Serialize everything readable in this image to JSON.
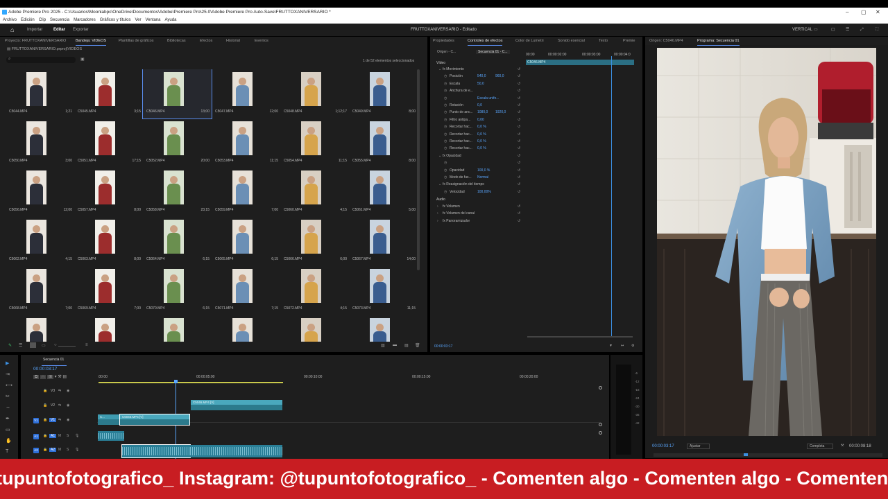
{
  "window": {
    "title": "Adobe Premiere Pro 2025 - C:\\Usuarios\\Moonlabpc\\OneDrive\\Documentos\\Adobe\\Premiere Pro\\25.0\\Adobe Premiere Pro Auto-Save\\FRUTTOXANIVERSARIO *",
    "min": "–",
    "max": "▢",
    "close": "✕"
  },
  "menu": [
    "Archivo",
    "Edición",
    "Clip",
    "Secuencia",
    "Marcadores",
    "Gráficos y títulos",
    "Ver",
    "Ventana",
    "Ayuda"
  ],
  "topbar": {
    "tabs": [
      "Importar",
      "Editar",
      "Exportar"
    ],
    "project_title": "FRUTTOXANIVERSARIO - Editado",
    "layout": "VERTICAL"
  },
  "project": {
    "tabs": [
      "Proyecto: FRUTTOXANIVERSARIO",
      "Bandeja: VIDEOS",
      "Plantillas de gráficos",
      "Bibliotecas",
      "Efectos",
      "Historial",
      "Eventos"
    ],
    "path": "FRUTTOXANIVERSARIO.prproj\\VIDEOS",
    "count": "1 de 52 elementos seleccionados",
    "clips": [
      {
        "name": "C5044.MP4",
        "dur": "1;21"
      },
      {
        "name": "C5045.MP4",
        "dur": "3;15"
      },
      {
        "name": "C5046.MP4",
        "dur": "13;00"
      },
      {
        "name": "C5047.MP4",
        "dur": "12;00"
      },
      {
        "name": "C5048.MP4",
        "dur": "1;12;17"
      },
      {
        "name": "C5049.MP4",
        "dur": "8;00"
      },
      {
        "name": "C5050.MP4",
        "dur": "3;00"
      },
      {
        "name": "C5051.MP4",
        "dur": "17;15"
      },
      {
        "name": "C5052.MP4",
        "dur": "20;00"
      },
      {
        "name": "C5053.MP4",
        "dur": "11;15"
      },
      {
        "name": "C5054.MP4",
        "dur": "11;15"
      },
      {
        "name": "C5055.MP4",
        "dur": "8;00"
      },
      {
        "name": "C5056.MP4",
        "dur": "12;00"
      },
      {
        "name": "C5057.MP4",
        "dur": "8;00"
      },
      {
        "name": "C5058.MP4",
        "dur": "23;15"
      },
      {
        "name": "C5059.MP4",
        "dur": "7;00"
      },
      {
        "name": "C5060.MP4",
        "dur": "4;15"
      },
      {
        "name": "C5061.MP4",
        "dur": "5;00"
      },
      {
        "name": "C5062.MP4",
        "dur": "4;15"
      },
      {
        "name": "C5063.MP4",
        "dur": "8;00"
      },
      {
        "name": "C5064.MP4",
        "dur": "6;15"
      },
      {
        "name": "C5065.MP4",
        "dur": "6;15"
      },
      {
        "name": "C5066.MP4",
        "dur": "6;00"
      },
      {
        "name": "C5067.MP4",
        "dur": "14;00"
      },
      {
        "name": "C5068.MP4",
        "dur": "7;00"
      },
      {
        "name": "C5069.MP4",
        "dur": "7;00"
      },
      {
        "name": "C5070.MP4",
        "dur": "6;15"
      },
      {
        "name": "C5071.MP4",
        "dur": "7;15"
      },
      {
        "name": "C5072.MP4",
        "dur": "4;15"
      },
      {
        "name": "C5073.MP4",
        "dur": "11;15"
      },
      {
        "name": "",
        "dur": ""
      },
      {
        "name": "",
        "dur": ""
      },
      {
        "name": "",
        "dur": ""
      },
      {
        "name": "",
        "dur": ""
      },
      {
        "name": "",
        "dur": ""
      },
      {
        "name": "",
        "dur": ""
      }
    ]
  },
  "effects": {
    "tabs": [
      "Propiedades",
      "Controles de efectos",
      "Color de Lumetri",
      "Sonido esencial",
      "Texto",
      "Premie"
    ],
    "source": "Origen - C...",
    "seq": "Secuencia 01 - C...",
    "ruler": [
      "00:00",
      "00:00:02:00",
      "00:00:03:00",
      "00:00:04:0"
    ],
    "clip_label": "C5046.MP4",
    "section_video": "Vídeo",
    "section_audio": "Audio",
    "rows": [
      {
        "label": "fx Movimiento",
        "v1": "",
        "v2": ""
      },
      {
        "label": "Posición",
        "v1": "540,0",
        "v2": "960,0"
      },
      {
        "label": "Escala",
        "v1": "50,0",
        "v2": ""
      },
      {
        "label": "Anchura de e...",
        "v1": "",
        "v2": ""
      },
      {
        "label": "",
        "v1": "Escala unifo...",
        "v2": ""
      },
      {
        "label": "Rotación",
        "v1": "0,0",
        "v2": ""
      },
      {
        "label": "Punto de anc...",
        "v1": "1080,0",
        "v2": "1920,0"
      },
      {
        "label": "Filtro antipa...",
        "v1": "0,00",
        "v2": ""
      },
      {
        "label": "Recortar hac...",
        "v1": "0,0 %",
        "v2": ""
      },
      {
        "label": "Recortar hac...",
        "v1": "0,0 %",
        "v2": ""
      },
      {
        "label": "Recortar hac...",
        "v1": "0,0 %",
        "v2": ""
      },
      {
        "label": "Recortar hac...",
        "v1": "0,0 %",
        "v2": ""
      },
      {
        "label": "fx Opacidad",
        "v1": "",
        "v2": ""
      },
      {
        "label": "",
        "v1": "",
        "v2": ""
      },
      {
        "label": "Opacidad",
        "v1": "100,0 %",
        "v2": ""
      },
      {
        "label": "Modo de fus...",
        "v1": "Normal",
        "v2": ""
      },
      {
        "label": "fx Reasignación del tiempo",
        "v1": "",
        "v2": ""
      },
      {
        "label": "Velocidad",
        "v1": "100,00%",
        "v2": ""
      }
    ],
    "audio_rows": [
      "fx Volumen",
      "fx Volumen del canal",
      "fx Panoramizador"
    ],
    "timecode": "00:00:03:17"
  },
  "program": {
    "tabs": [
      "Origen: C5046.MP4",
      "Programa: Secuencia 01"
    ],
    "timecode": "00:00:03:17",
    "fit": "Ajustar",
    "quality": "Completa",
    "duration": "00:00:08:18"
  },
  "timeline": {
    "tab": "Secuencia 01",
    "timecode": "00:00:03:17",
    "ruler": [
      ":00:00",
      "00:00:05:00",
      "00:00:10:00",
      "00:00:15:00",
      "00:00:20:00"
    ],
    "tracks": [
      "V3",
      "V2",
      "V1",
      "A1",
      "A2"
    ],
    "src_v": "V1",
    "src_a1": "A1",
    "src_a2": "A2",
    "clips": {
      "v2": "C5046.MP4 [V]",
      "v1a": "C...",
      "v1b": "C5046.MP4 [V]"
    },
    "meter": [
      "-6",
      "-12",
      "-18",
      "-24",
      "-30",
      "-36",
      "-42"
    ]
  },
  "ticker": "tupuntofotografico_   Instagram: @tupuntofotografico_   - Comenten algo   - Comenten algo   - Comenten algo",
  "colors": {
    "accent": "#5a8dee",
    "ticker": "#c81d22",
    "clip": "#2c7a8c"
  }
}
